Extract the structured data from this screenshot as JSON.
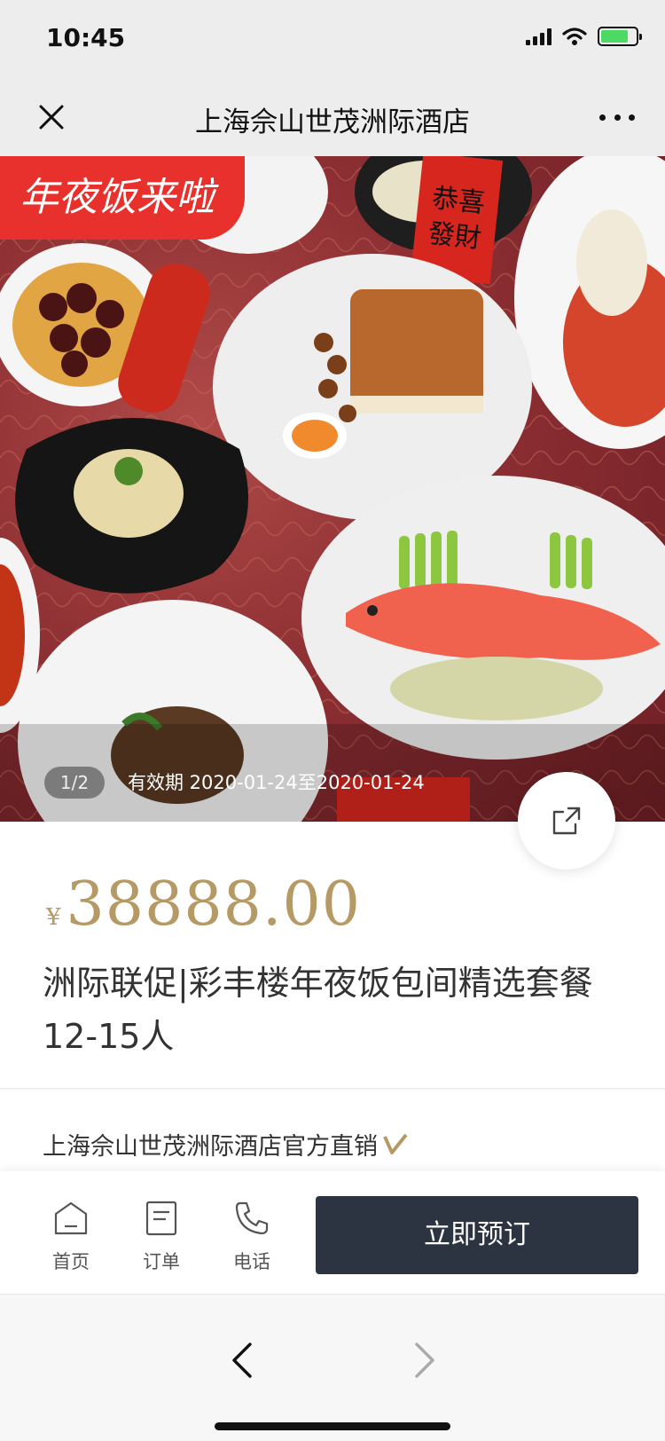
{
  "status_bar": {
    "time": "10:45",
    "battery_level": 0.8
  },
  "nav": {
    "title": "上海佘山世茂洲际酒店"
  },
  "hero": {
    "promo_tag": "年夜饭来啦",
    "image_counter": "1/2",
    "validity": "有效期 2020-01-24至2020-01-24",
    "couplet_text": "恭喜發財"
  },
  "product": {
    "currency": "¥",
    "price": "38888.00",
    "title": "洲际联促|彩丰楼年夜饭包间精选套餐12-15人"
  },
  "seller": {
    "name": "上海佘山世茂洲际酒店官方直销"
  },
  "actions": {
    "home_label": "首页",
    "orders_label": "订单",
    "phone_label": "电话",
    "book_label": "立即预订"
  },
  "colors": {
    "accent_gold": "#b59a65",
    "promo_red": "#e8302c",
    "button_dark": "#2b3440"
  },
  "icons": [
    "close-icon",
    "more-icon",
    "share-icon",
    "verified-icon",
    "home-icon",
    "order-icon",
    "phone-icon",
    "back-chevron-icon",
    "forward-chevron-icon"
  ]
}
